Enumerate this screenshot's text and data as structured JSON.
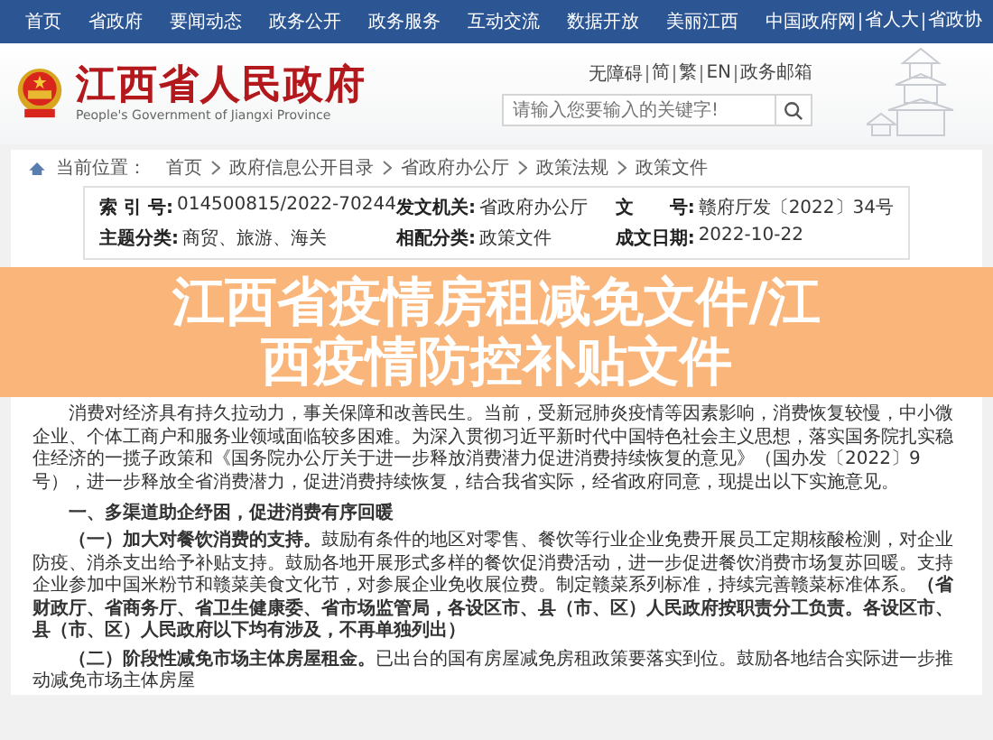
{
  "nav": {
    "items": [
      "首页",
      "省政府",
      "要闻动态",
      "政务公开",
      "政务服务",
      "互动交流",
      "数据开放",
      "美丽江西"
    ],
    "links": [
      "中国政府网",
      "省人大",
      "省政协"
    ]
  },
  "header": {
    "title": "江西省人民政府",
    "subtitle": "People's Government of Jiangxi Province",
    "utility_links": [
      "无障碍",
      "简",
      "繁",
      "EN",
      "政务邮箱"
    ],
    "search": {
      "placeholder": "请输入您要输入的关键字!"
    }
  },
  "breadcrumb": {
    "label": "当前位置：",
    "items": [
      "首页",
      "政府信息公开目录",
      "省政府办公厅",
      "政策法规",
      "政策文件"
    ]
  },
  "meta": [
    {
      "label": "索 引 号:",
      "value": "014500815/2022-70244"
    },
    {
      "label": "发文机关:",
      "value": "省政府办公厅"
    },
    {
      "label": "文　　号:",
      "value": "赣府厅发〔2022〕34号"
    },
    {
      "label": "主题分类:",
      "value": "商贸、旅游、海关"
    },
    {
      "label": "相配分类:",
      "value": "政策文件"
    },
    {
      "label": "成文日期:",
      "value": "2022-10-22"
    }
  ],
  "document": {
    "paragraphs": [
      {
        "kind": "text",
        "text": "消费对经济具有持久拉动力，事关保障和改善民生。当前，受新冠肺炎疫情等因素影响，消费恢复较慢，中小微企业、个体工商户和服务业领域面临较多困难。为深入贯彻习近平新时代中国特色社会主义思想，落实国务院扎实稳住经济的一揽子政策和《国务院办公厅关于进一步释放消费潜力促进消费持续恢复的意见》（国办发〔2022〕9号），进一步释放全省消费潜力，促进消费持续恢复，结合我省实际，经省政府同意，现提出以下实施意见。"
      },
      {
        "kind": "heading",
        "text": "一、多渠道助企纾困，促进消费有序回暖"
      },
      {
        "kind": "text",
        "text": "**（一）加大对餐饮消费的支持。**鼓励有条件的地区对零售、餐饮等行业企业免费开展员工定期核酸检测，对企业防疫、消杀支出给予补贴支持。鼓励各地开展形式多样的餐饮促消费活动，进一步促进餐饮消费市场复苏回暖。支持企业参加中国米粉节和赣菜美食文化节，对参展企业免收展位费。制定赣菜系列标准，持续完善赣菜标准体系。**（省财政厅、省商务厅、省卫生健康委、省市场监管局，各设区市、县（市、区）人民政府按职责分工负责。各设区市、县（市、区）人民政府以下均有涉及，不再单独列出）**"
      },
      {
        "kind": "text",
        "text": "**（二）阶段性减免市场主体房屋租金。**已出台的国有房屋减免房租政策要落实到位。鼓励各地结合实际进一步推动减免市场主体房屋"
      }
    ]
  },
  "banner": {
    "title": "江西省疫情房租减免文件/江西疫情防控补贴文件"
  }
}
